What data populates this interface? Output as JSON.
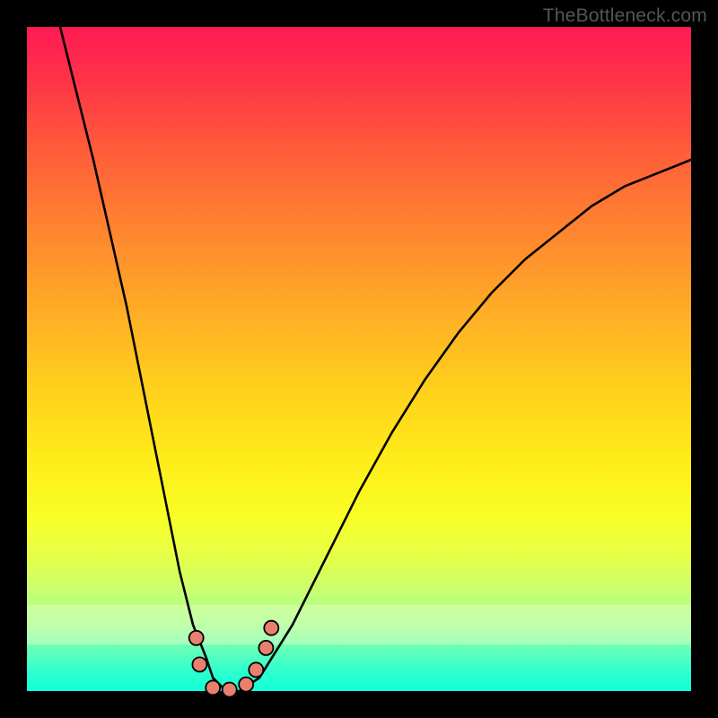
{
  "watermark": "TheBottleneck.com",
  "chart_data": {
    "type": "line",
    "title": "",
    "xlabel": "",
    "ylabel": "",
    "xlim": [
      0,
      100
    ],
    "ylim": [
      0,
      100
    ],
    "grid": false,
    "legend": false,
    "background_gradient": {
      "top": "#ff1a54",
      "bottom": "#14ffd8",
      "stops": [
        "#ff1a54",
        "#ff5a3a",
        "#ffaa26",
        "#ffee1a",
        "#c8ff70",
        "#2effcf"
      ]
    },
    "series": [
      {
        "name": "curve",
        "color": "#000000",
        "x": [
          5,
          10,
          15,
          20,
          23,
          25,
          27,
          28,
          29,
          30,
          32,
          35,
          40,
          45,
          50,
          55,
          60,
          65,
          70,
          75,
          80,
          85,
          90,
          95,
          100
        ],
        "y": [
          100,
          80,
          58,
          33,
          18,
          10,
          5,
          2,
          1,
          0,
          0,
          2,
          10,
          20,
          30,
          39,
          47,
          54,
          60,
          65,
          69,
          73,
          76,
          78,
          80
        ]
      }
    ],
    "markers": {
      "name": "points",
      "color": "#e9806f",
      "border": "#000000",
      "x": [
        25.5,
        26,
        28,
        30.5,
        33,
        34.5,
        36,
        36.8
      ],
      "y": [
        8,
        4,
        0.5,
        0.2,
        1,
        3.2,
        6.5,
        9.5
      ]
    }
  }
}
